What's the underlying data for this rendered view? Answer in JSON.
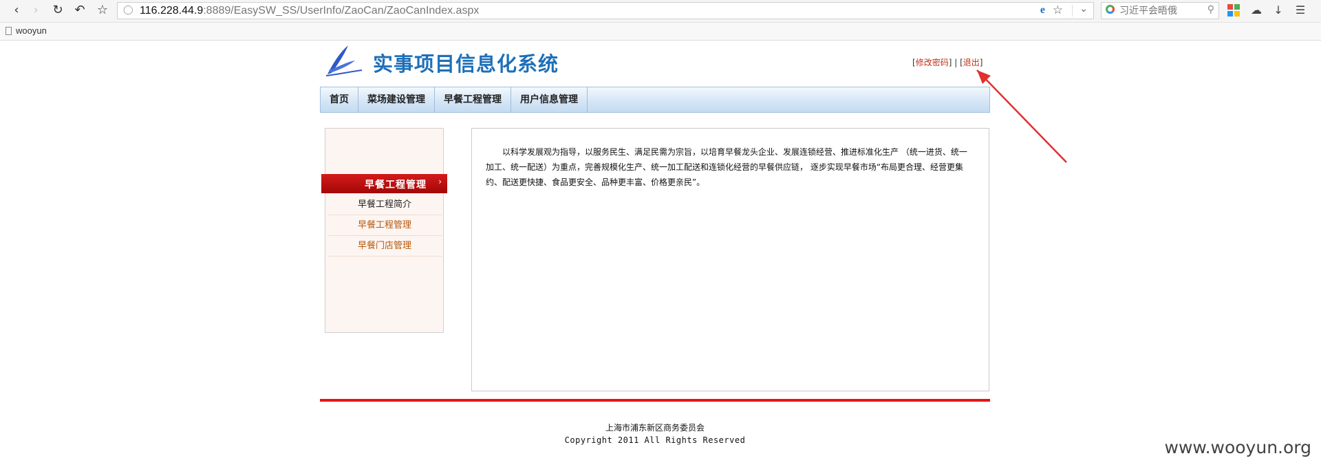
{
  "browser": {
    "url_host": "116.228.44.9",
    "url_rest": ":8889/EasySW_SS/UserInfo/ZaoCan/ZaoCanIndex.aspx",
    "search_placeholder": "习近平会晤俄",
    "bookmark": "wooyun"
  },
  "header": {
    "title": "实事项目信息化系统",
    "change_password": "修改密码",
    "separator": "|",
    "logout": "退出",
    "logo_color": "#3a5ec8"
  },
  "nav": {
    "items": [
      {
        "label": "首页"
      },
      {
        "label": "菜场建设管理"
      },
      {
        "label": "早餐工程管理"
      },
      {
        "label": "用户信息管理"
      }
    ]
  },
  "sidebar": {
    "active": "早餐工程管理",
    "items": [
      {
        "label": "早餐工程简介"
      },
      {
        "label": "早餐工程管理"
      },
      {
        "label": "早餐门店管理"
      }
    ]
  },
  "content": {
    "text": "以科学发展观为指导，以服务民生、满足民需为宗旨，以培育早餐龙头企业、发展连锁经营、推进标准化生产 （统一进货、统一加工、统一配送）为重点，完善规模化生产、统一加工配送和连锁化经营的早餐供应链， 逐步实现早餐市场“布局更合理、经营更集约、配送更快捷、食品更安全、品种更丰富、价格更亲民”。"
  },
  "footer": {
    "org": "上海市浦东新区商务委员会",
    "copyright": "Copyright 2011 All Rights Reserved"
  },
  "watermark": "www.wooyun.org",
  "colors": {
    "accent_red": "#e31414",
    "title_blue": "#1e6fb8",
    "annotation_red": "#e03030"
  }
}
